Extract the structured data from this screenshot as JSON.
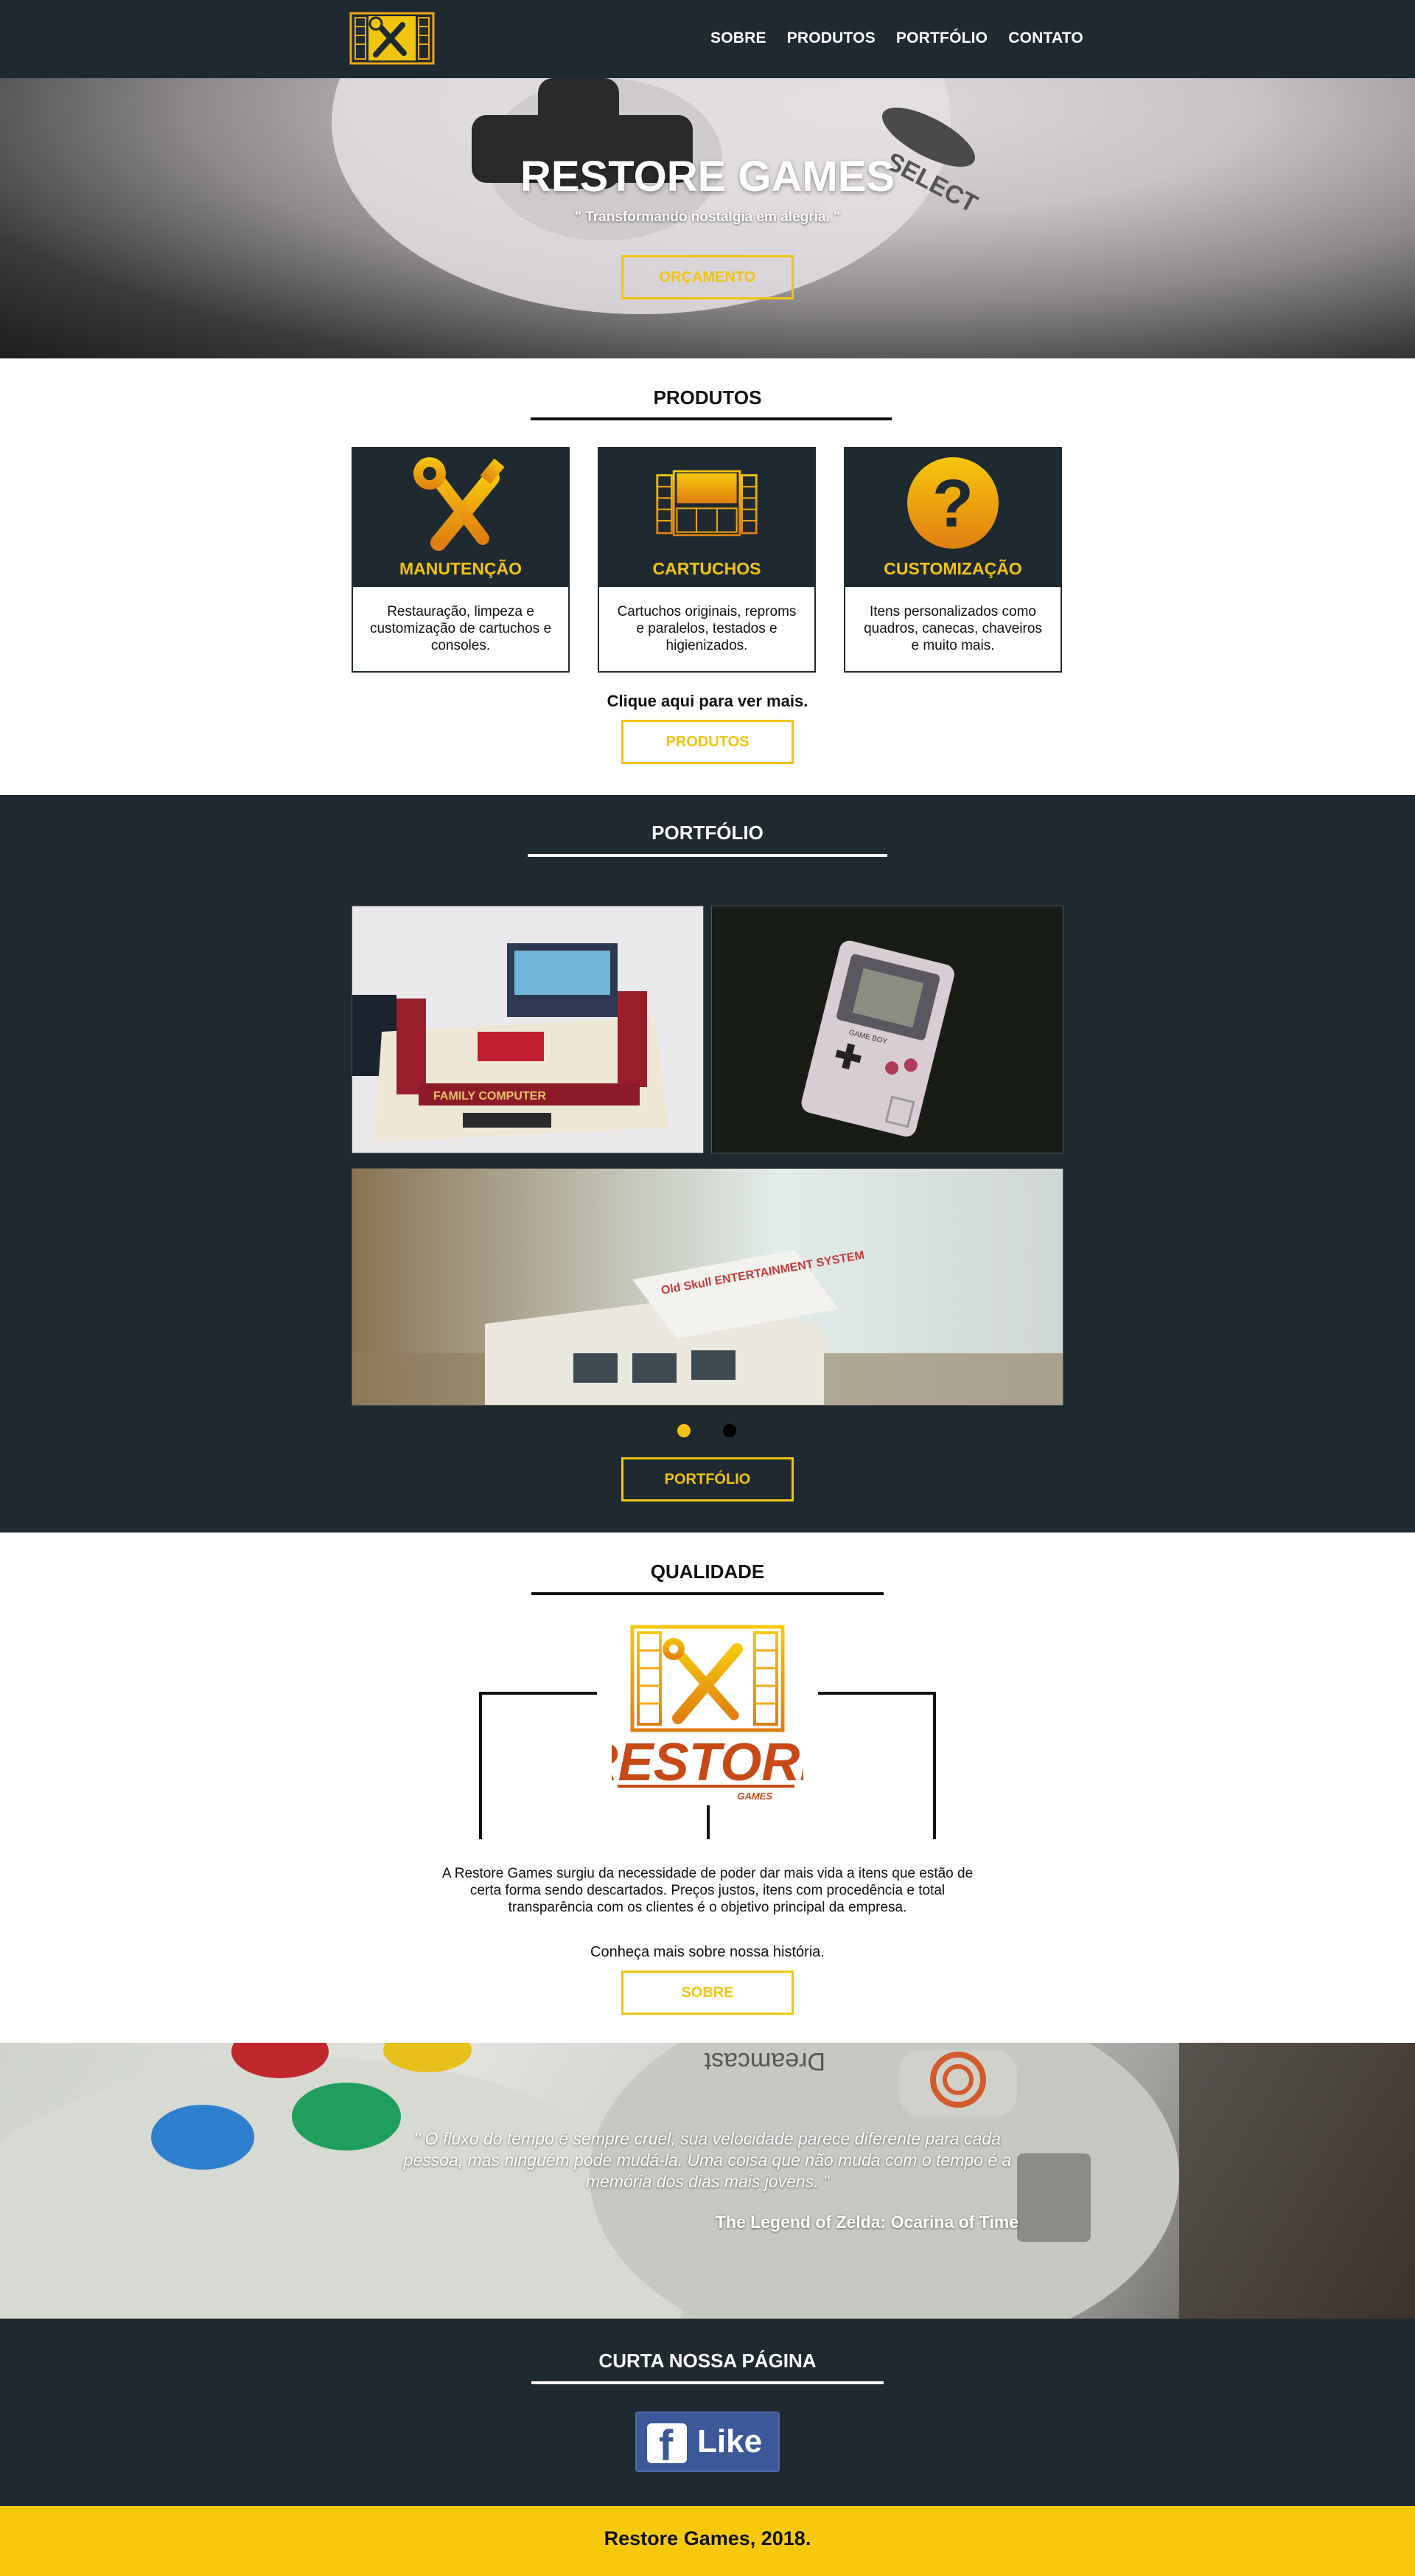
{
  "nav": {
    "items": [
      {
        "label": "SOBRE"
      },
      {
        "label": "PRODUTOS"
      },
      {
        "label": "PORTFÓLIO"
      },
      {
        "label": "CONTATO"
      }
    ]
  },
  "hero": {
    "title": "RESTORE GAMES",
    "tagline": "\" Transformando nostalgia em alegria. \"",
    "cta": "ORÇAMENTO"
  },
  "produtos": {
    "title": "PRODUTOS",
    "cards": [
      {
        "name": "MANUTENÇÃO",
        "desc": "Restauração, limpeza e customização de cartuchos e consoles.",
        "icon": "tools-icon"
      },
      {
        "name": "CARTUCHOS",
        "desc": "Cartuchos originais, reproms e paralelos, testados e higienizados.",
        "icon": "cartridge-icon"
      },
      {
        "name": "CUSTOMIZAÇÃO",
        "desc": "Itens personalizados como quadros, canecas, chaveiros e muito mais.",
        "icon": "question-icon"
      }
    ],
    "more": "Clique aqui para ver mais.",
    "button": "PRODUTOS"
  },
  "portfolio": {
    "title": "PORTFÓLIO",
    "photo_labels": [
      "FAMILY COMPUTER",
      "GAME BOY",
      "Old Skull ENTERTAINMENT SYSTEM"
    ],
    "button": "PORTFÓLIO",
    "active_slide": 1,
    "slide_count": 2
  },
  "qualidade": {
    "title": "QUALIDADE",
    "logo_word": "RESTORE",
    "logo_sub": "GAMES",
    "text": "A Restore Games surgiu da necessidade de poder dar mais vida a itens que estão de certa forma sendo descartados. Preços justos, itens com procedência e total transparência com os clientes é o objetivo principal da empresa.",
    "more": "Conheça mais sobre nossa história.",
    "button": "SOBRE"
  },
  "quote": {
    "text": "\" O fluxo do tempo é sempre cruel, sua velocidade parece diferente para cada pessoa, mas ninguém pode mudá-la. Uma coisa que não muda com o tempo é a memória dos dias mais jovens. \"",
    "author": "The Legend of Zelda: Ocarina of Time",
    "console_label": "Dreamcast"
  },
  "social": {
    "title": "CURTA NOSSA PÁGINA",
    "like": "Like",
    "f": "f"
  },
  "footer": {
    "text": "Restore Games, 2018."
  },
  "colors": {
    "dark": "#1f2a30",
    "accent": "#f2c40f",
    "footer": "#f7c90a",
    "facebook": "#3b5998"
  }
}
